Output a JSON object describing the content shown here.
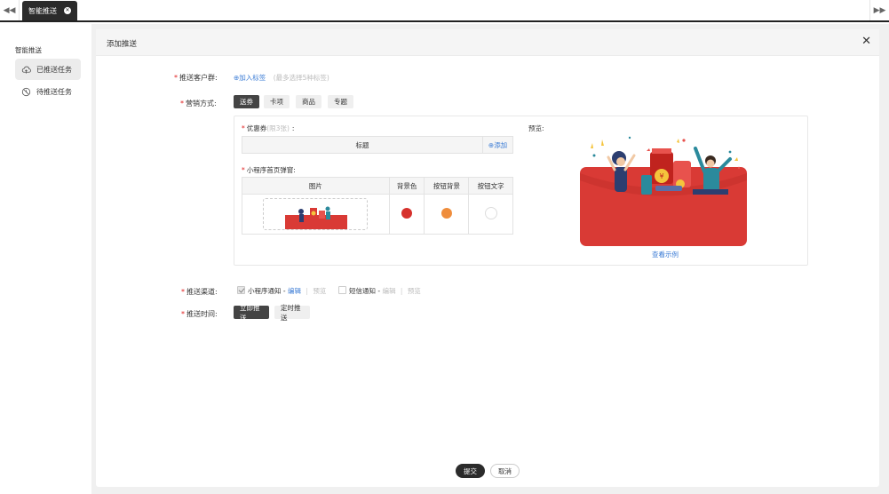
{
  "tabbar": {
    "nav_left_icon": "double-chevron-left-icon",
    "nav_right_icon": "double-chevron-right-icon",
    "active_tab_label": "智能推送",
    "close_icon": "close-circle-icon"
  },
  "sidebar": {
    "title": "智能推送",
    "items": [
      {
        "label": "已推送任务",
        "icon": "cloud-push-icon",
        "active": true
      },
      {
        "label": "待推送任务",
        "icon": "clock-cancel-icon",
        "active": false
      }
    ]
  },
  "panel": {
    "title": "添加推送",
    "close_icon": "close-icon"
  },
  "form": {
    "customer_group": {
      "label": "推送客户群:",
      "add_tag_link": "加入标签",
      "hint": "(最多选择5种标签)"
    },
    "marketing": {
      "label": "营销方式:",
      "options": [
        "送券",
        "卡项",
        "商品",
        "专题"
      ],
      "selected": "送券"
    },
    "coupon": {
      "label": "优惠券",
      "hint": "(限3张)",
      "colon": ":",
      "table_header": "标题",
      "add_link": "添加"
    },
    "popup": {
      "label": "小程序首页弹窗:",
      "headers": [
        "图片",
        "背景色",
        "按钮背景",
        "按钮文字"
      ],
      "bg_color": "#d6312c",
      "button_bg_color": "#ef8d3c",
      "button_text_color": "#ffffff"
    },
    "preview": {
      "label": "预览:",
      "example_link": "查看示例",
      "card_color": "#d93a35"
    },
    "channel": {
      "label": "推送渠道:",
      "miniprogram": {
        "label": "小程序通知",
        "dash": "-",
        "edit": "编辑",
        "preview": "预览",
        "checked": true
      },
      "sms": {
        "label": "短信通知",
        "dash": "-",
        "edit": "编辑",
        "preview": "预览",
        "checked": false
      },
      "separator": "|"
    },
    "time": {
      "label": "推送时间:",
      "options": [
        "立即推送",
        "定时推送"
      ],
      "selected": "立即推送"
    }
  },
  "footer": {
    "submit": "提交",
    "cancel": "取消"
  }
}
